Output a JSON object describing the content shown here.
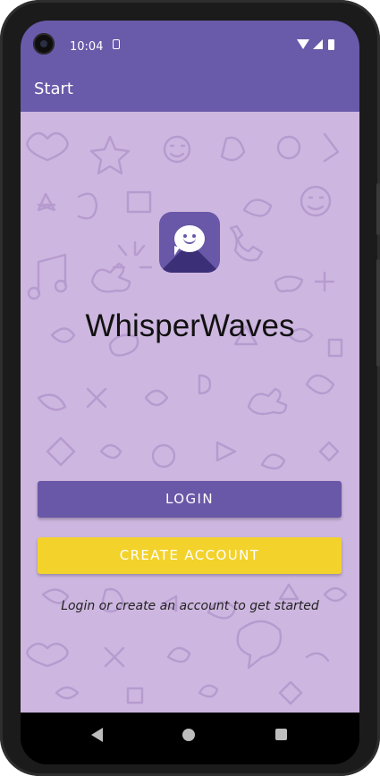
{
  "status_bar": {
    "time": "10:04"
  },
  "app_bar": {
    "title": "Start"
  },
  "app": {
    "name": "WhisperWaves"
  },
  "actions": {
    "login_label": "LOGIN",
    "create_account_label": "CREATE ACCOUNT"
  },
  "hint_text": "Login or create an account to get started",
  "icons": [
    "sim-icon",
    "wifi-icon",
    "signal-icon",
    "battery-icon",
    "chat-bubble-icon",
    "back-icon",
    "home-icon",
    "recents-icon"
  ],
  "colors": {
    "primary": "#6a5aaa",
    "accent": "#f3d22c",
    "background": "#cdb6df"
  }
}
